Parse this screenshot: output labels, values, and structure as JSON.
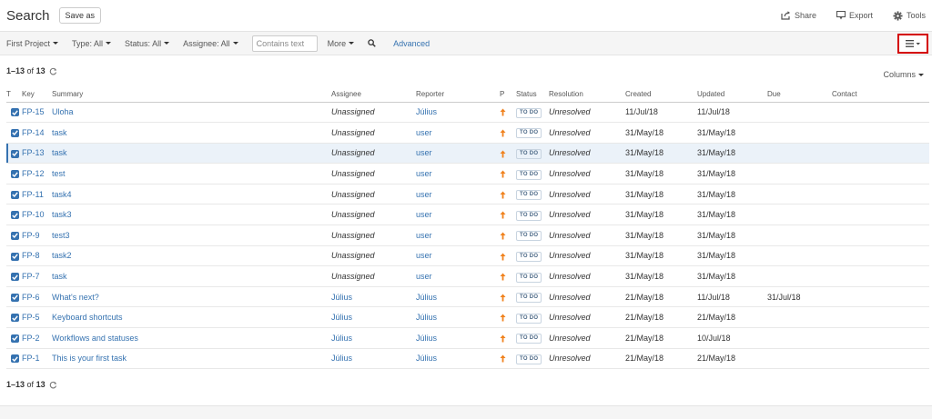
{
  "header": {
    "title": "Search",
    "save_as_label": "Save as",
    "share_label": "Share",
    "export_label": "Export",
    "tools_label": "Tools"
  },
  "filters": {
    "project": "First Project",
    "type": "Type: All",
    "status": "Status: All",
    "assignee": "Assignee: All",
    "contains_placeholder": "Contains text",
    "more": "More",
    "advanced": "Advanced"
  },
  "results": {
    "range": "1–13",
    "of_label": "of",
    "total": "13"
  },
  "columns_label": "Columns",
  "table": {
    "headers": [
      "T",
      "Key",
      "Summary",
      "Assignee",
      "Reporter",
      "P",
      "Status",
      "Resolution",
      "Created",
      "Updated",
      "Due",
      "Contact"
    ],
    "rows": [
      {
        "key": "FP-15",
        "summary": "Uloha",
        "assignee": "Unassigned",
        "reporter": "Július",
        "status": "TO DO",
        "resolution": "Unresolved",
        "created": "11/Jul/18",
        "updated": "11/Jul/18",
        "due": "",
        "contact": ""
      },
      {
        "key": "FP-14",
        "summary": "task",
        "assignee": "Unassigned",
        "reporter": "user",
        "status": "TO DO",
        "resolution": "Unresolved",
        "created": "31/May/18",
        "updated": "31/May/18",
        "due": "",
        "contact": ""
      },
      {
        "key": "FP-13",
        "summary": "task",
        "assignee": "Unassigned",
        "reporter": "user",
        "status": "TO DO",
        "resolution": "Unresolved",
        "created": "31/May/18",
        "updated": "31/May/18",
        "due": "",
        "contact": ""
      },
      {
        "key": "FP-12",
        "summary": "test",
        "assignee": "Unassigned",
        "reporter": "user",
        "status": "TO DO",
        "resolution": "Unresolved",
        "created": "31/May/18",
        "updated": "31/May/18",
        "due": "",
        "contact": ""
      },
      {
        "key": "FP-11",
        "summary": "task4",
        "assignee": "Unassigned",
        "reporter": "user",
        "status": "TO DO",
        "resolution": "Unresolved",
        "created": "31/May/18",
        "updated": "31/May/18",
        "due": "",
        "contact": ""
      },
      {
        "key": "FP-10",
        "summary": "task3",
        "assignee": "Unassigned",
        "reporter": "user",
        "status": "TO DO",
        "resolution": "Unresolved",
        "created": "31/May/18",
        "updated": "31/May/18",
        "due": "",
        "contact": ""
      },
      {
        "key": "FP-9",
        "summary": "test3",
        "assignee": "Unassigned",
        "reporter": "user",
        "status": "TO DO",
        "resolution": "Unresolved",
        "created": "31/May/18",
        "updated": "31/May/18",
        "due": "",
        "contact": ""
      },
      {
        "key": "FP-8",
        "summary": "task2",
        "assignee": "Unassigned",
        "reporter": "user",
        "status": "TO DO",
        "resolution": "Unresolved",
        "created": "31/May/18",
        "updated": "31/May/18",
        "due": "",
        "contact": ""
      },
      {
        "key": "FP-7",
        "summary": "task",
        "assignee": "Unassigned",
        "reporter": "user",
        "status": "TO DO",
        "resolution": "Unresolved",
        "created": "31/May/18",
        "updated": "31/May/18",
        "due": "",
        "contact": ""
      },
      {
        "key": "FP-6",
        "summary": "What's next?",
        "assignee": "Július",
        "reporter": "Július",
        "status": "TO DO",
        "resolution": "Unresolved",
        "created": "21/May/18",
        "updated": "11/Jul/18",
        "due": "31/Jul/18",
        "contact": ""
      },
      {
        "key": "FP-5",
        "summary": "Keyboard shortcuts",
        "assignee": "Július",
        "reporter": "Július",
        "status": "TO DO",
        "resolution": "Unresolved",
        "created": "21/May/18",
        "updated": "21/May/18",
        "due": "",
        "contact": ""
      },
      {
        "key": "FP-2",
        "summary": "Workflows and statuses",
        "assignee": "Július",
        "reporter": "Július",
        "status": "TO DO",
        "resolution": "Unresolved",
        "created": "21/May/18",
        "updated": "10/Jul/18",
        "due": "",
        "contact": ""
      },
      {
        "key": "FP-1",
        "summary": "This is your first task",
        "assignee": "Július",
        "reporter": "Július",
        "status": "TO DO",
        "resolution": "Unresolved",
        "created": "21/May/18",
        "updated": "21/May/18",
        "due": "",
        "contact": ""
      }
    ]
  },
  "colors": {
    "link": "#3572b0",
    "priority": "#f0821e",
    "highlight_border": "#d40000",
    "selected_row": "#ebf2f9"
  },
  "icons": {
    "share": "share-icon",
    "export": "export-icon",
    "tools": "gear-icon",
    "search": "search-icon",
    "refresh": "refresh-icon",
    "layout": "list-view-icon",
    "priority": "arrow-up-icon",
    "type": "task-checkbox-icon"
  }
}
